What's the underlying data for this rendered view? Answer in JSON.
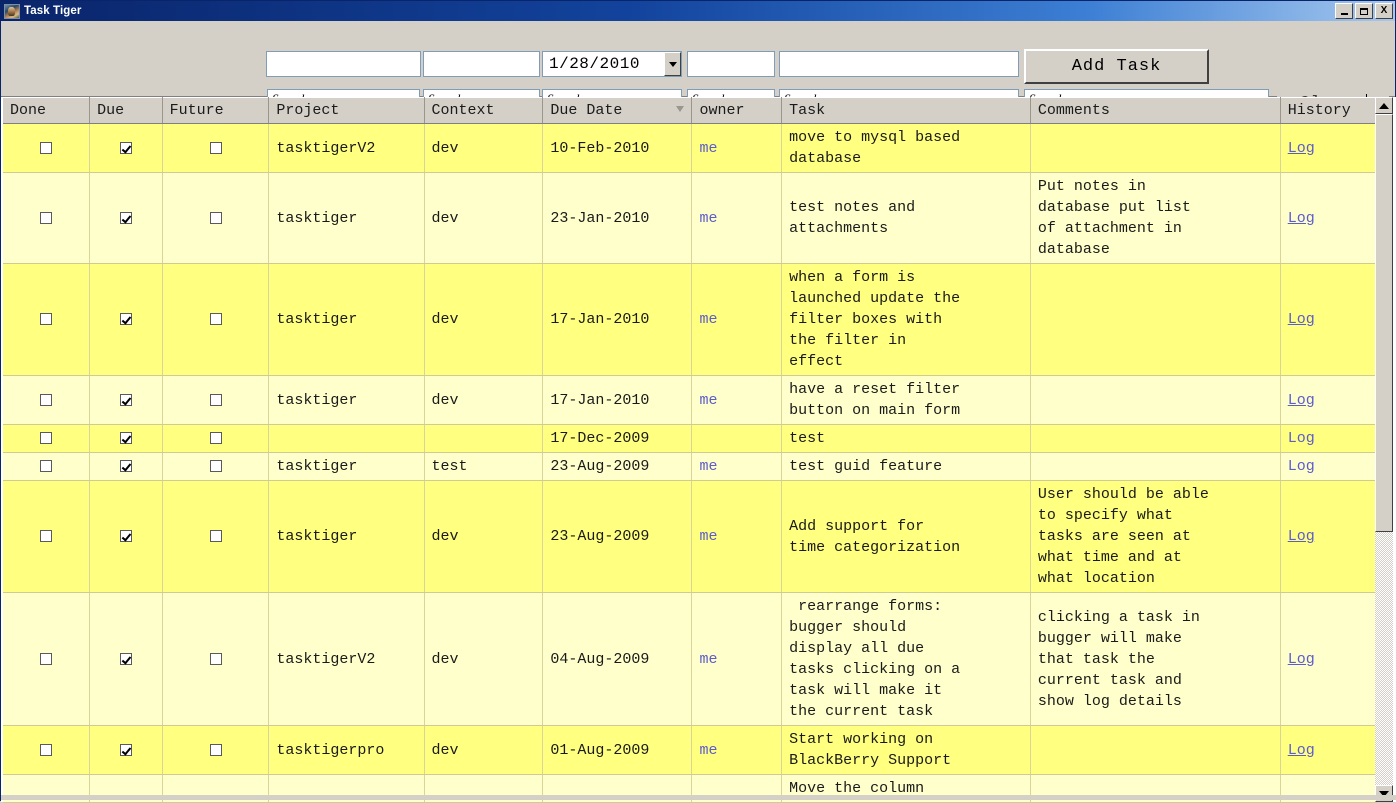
{
  "window": {
    "title": "Task Tiger",
    "icon": "tiger-photo-icon",
    "minimize_label": "_",
    "maximize_label": "□",
    "close_label": "X"
  },
  "toolbar": {
    "add_task_label": "Add Task",
    "clear_label": "Clear",
    "project_value": "",
    "context_value": "",
    "date_value": "1/28/2010",
    "owner_value": "",
    "task_value": "",
    "search_placeholder": "Search",
    "filters": {
      "done_checked": false,
      "due_checked": true,
      "future_checked": false,
      "future_disabled": true
    }
  },
  "grid": {
    "columns": [
      {
        "key": "done",
        "label": "Done",
        "sorted": false
      },
      {
        "key": "due",
        "label": "Due",
        "sorted": false
      },
      {
        "key": "future",
        "label": "Future",
        "sorted": false
      },
      {
        "key": "project",
        "label": "Project",
        "sorted": false
      },
      {
        "key": "context",
        "label": "Context",
        "sorted": false
      },
      {
        "key": "due_date",
        "label": "Due Date",
        "sorted": true
      },
      {
        "key": "owner",
        "label": "owner",
        "sorted": false
      },
      {
        "key": "task",
        "label": "Task",
        "sorted": false
      },
      {
        "key": "comments",
        "label": "Comments",
        "sorted": false
      },
      {
        "key": "history",
        "label": "History",
        "sorted": false
      }
    ],
    "history_link_label": "Log",
    "rows": [
      {
        "done": false,
        "due": true,
        "future": false,
        "project": "tasktigerV2",
        "context": "dev",
        "due_date": "10-Feb-2010",
        "owner": "me",
        "task": "move to mysql based\ndatabase",
        "comments": "",
        "history": "Log"
      },
      {
        "done": false,
        "due": true,
        "future": false,
        "project": "tasktiger",
        "context": "dev",
        "due_date": "23-Jan-2010",
        "owner": "me",
        "task": "test notes and\nattachments",
        "comments": "Put notes in\ndatabase put list\nof attachment in\ndatabase",
        "history": "Log"
      },
      {
        "done": false,
        "due": true,
        "future": false,
        "project": "tasktiger",
        "context": "dev",
        "due_date": "17-Jan-2010",
        "owner": "me",
        "task": "when a form is\nlaunched update the\nfilter boxes with\nthe filter in\neffect",
        "comments": "",
        "history": "Log"
      },
      {
        "done": false,
        "due": true,
        "future": false,
        "project": "tasktiger",
        "context": "dev",
        "due_date": "17-Jan-2010",
        "owner": "me",
        "task": "have a reset filter\nbutton on main form",
        "comments": "",
        "history": "Log"
      },
      {
        "done": false,
        "due": true,
        "future": false,
        "project": "",
        "context": "",
        "due_date": "17-Dec-2009",
        "owner": "",
        "task": "test",
        "comments": "",
        "history": "Log"
      },
      {
        "done": false,
        "due": true,
        "future": false,
        "project": "tasktiger",
        "context": "test",
        "due_date": "23-Aug-2009",
        "owner": "me",
        "task": "test guid feature",
        "comments": "",
        "history": "Log"
      },
      {
        "done": false,
        "due": true,
        "future": false,
        "project": "tasktiger",
        "context": "dev",
        "due_date": "23-Aug-2009",
        "owner": "me",
        "task": "Add support for\ntime categorization",
        "comments": "User should be able\nto specify what\ntasks are seen at\nwhat time and at\nwhat location",
        "history": "Log"
      },
      {
        "done": false,
        "due": true,
        "future": false,
        "project": "tasktigerV2",
        "context": "dev",
        "due_date": "04-Aug-2009",
        "owner": "me",
        "task": " rearrange forms:\nbugger should\ndisplay all due\ntasks clicking on a\ntask will make it\nthe current task",
        "comments": "clicking a task in\nbugger will make\nthat task the\ncurrent task and\nshow log details",
        "history": "Log"
      },
      {
        "done": false,
        "due": true,
        "future": false,
        "project": "tasktigerpro",
        "context": "dev",
        "due_date": "01-Aug-2009",
        "owner": "me",
        "task": "Start working on\nBlackBerry Support",
        "comments": "",
        "history": "Log"
      },
      {
        "done": null,
        "due": null,
        "future": null,
        "project": "",
        "context": "",
        "due_date": "",
        "owner": "",
        "task": "Move the column",
        "comments": "",
        "history": ""
      }
    ]
  },
  "colors": {
    "row_odd": "#ffff80",
    "row_even": "#ffffcc",
    "chrome": "#d4d0c8",
    "titlebar": "#0a246a",
    "link": "#5c5ccc"
  }
}
